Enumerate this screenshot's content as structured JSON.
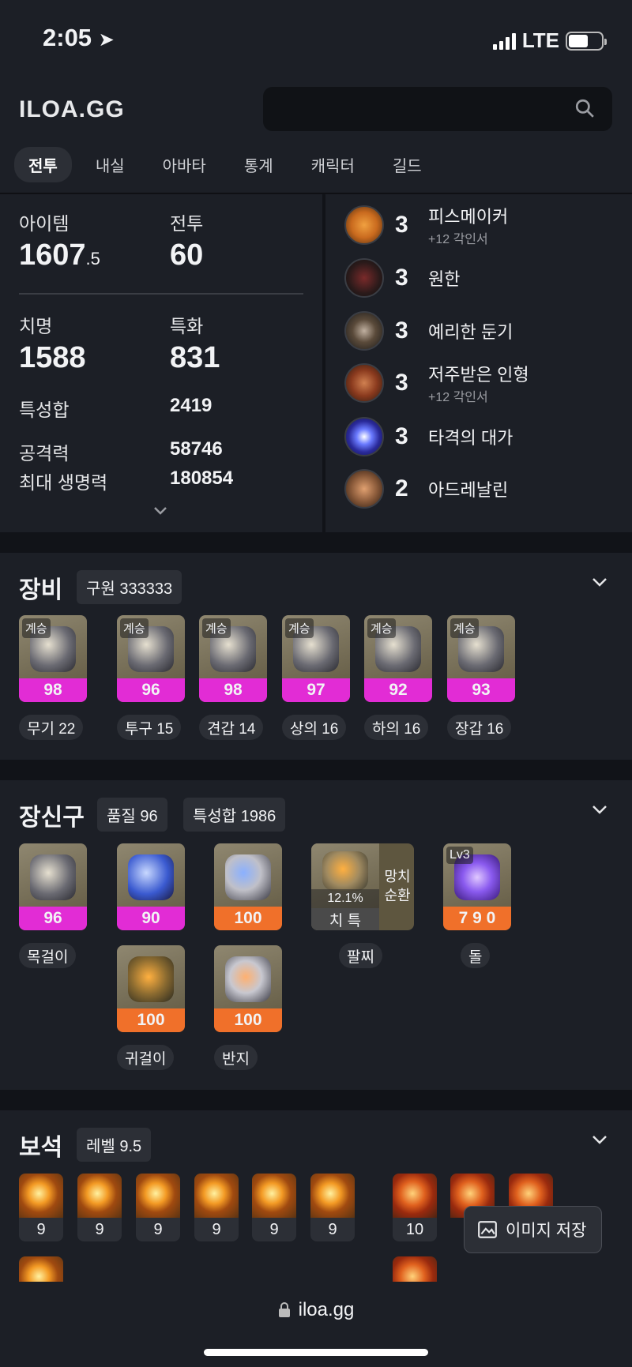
{
  "status": {
    "time": "2:05",
    "network": "LTE"
  },
  "header": {
    "logo": "ILOA.GG",
    "search_placeholder": "",
    "tabs": [
      "전투",
      "내실",
      "아바타",
      "통계",
      "캐릭터",
      "길드"
    ]
  },
  "stats": {
    "item_label": "아이템",
    "item_level_main": "1607",
    "item_level_decimal": ".5",
    "combat_label": "전투",
    "combat_level": "60",
    "crit_label": "치명",
    "crit_value": "1588",
    "spec_label": "특화",
    "spec_value": "831",
    "stat_sum_label": "특성합",
    "stat_sum_value": "2419",
    "attack_label": "공격력",
    "attack_value": "58746",
    "hp_label": "최대 생명력",
    "hp_value": "180854"
  },
  "engravings": [
    {
      "level": "3",
      "name": "피스메이커",
      "sub": "+12 각인서",
      "icon": "peacemaker-engraving-icon",
      "color": "#c96a1e"
    },
    {
      "level": "3",
      "name": "원한",
      "sub": "",
      "icon": "grudge-engraving-icon",
      "color": "#3a3a3a"
    },
    {
      "level": "3",
      "name": "예리한 둔기",
      "sub": "",
      "icon": "keen-blunt-weapon-engraving-icon",
      "color": "#5a4a3a"
    },
    {
      "level": "3",
      "name": "저주받은 인형",
      "sub": "+12 각인서",
      "icon": "cursed-doll-engraving-icon",
      "color": "#8a3a1e"
    },
    {
      "level": "3",
      "name": "타격의 대가",
      "sub": "",
      "icon": "hit-master-engraving-icon",
      "color": "#3a4aff"
    },
    {
      "level": "2",
      "name": "아드레날린",
      "sub": "",
      "icon": "adrenaline-engraving-icon",
      "color": "#8a5a3a"
    }
  ],
  "equipment": {
    "title": "장비",
    "tag": "구원 333333",
    "items": [
      {
        "tier": "계승",
        "quality": "98",
        "label": "무기 22"
      },
      {
        "tier": "계승",
        "quality": "96",
        "label": "투구 15"
      },
      {
        "tier": "계승",
        "quality": "98",
        "label": "견갑 14"
      },
      {
        "tier": "계승",
        "quality": "97",
        "label": "상의 16"
      },
      {
        "tier": "계승",
        "quality": "92",
        "label": "하의 16"
      },
      {
        "tier": "계승",
        "quality": "93",
        "label": "장갑 16"
      }
    ]
  },
  "accessories": {
    "title": "장신구",
    "tag_quality": "품질 96",
    "tag_stats": "특성합 1986",
    "necklace": {
      "quality": "96",
      "label": "목걸이"
    },
    "earring1": {
      "quality": "90"
    },
    "earring2": {
      "quality": "100",
      "label": "귀걸이"
    },
    "ring1": {
      "quality": "100"
    },
    "ring2": {
      "quality": "100",
      "label": "반지"
    },
    "bracelet": {
      "percent": "12.1%",
      "stats": "치 특",
      "effects_line1": "망치",
      "effects_line2": "순환",
      "label": "팔찌"
    },
    "stone": {
      "level": "Lv3",
      "value": "7 9 0",
      "label": "돌"
    }
  },
  "gems": {
    "title": "보석",
    "tag": "레벨 9.5",
    "fire_levels": [
      "9",
      "9",
      "9",
      "9",
      "9",
      "9"
    ],
    "red_levels": [
      "10"
    ]
  },
  "save_button": "이미지 저장",
  "url": "iloa.gg"
}
